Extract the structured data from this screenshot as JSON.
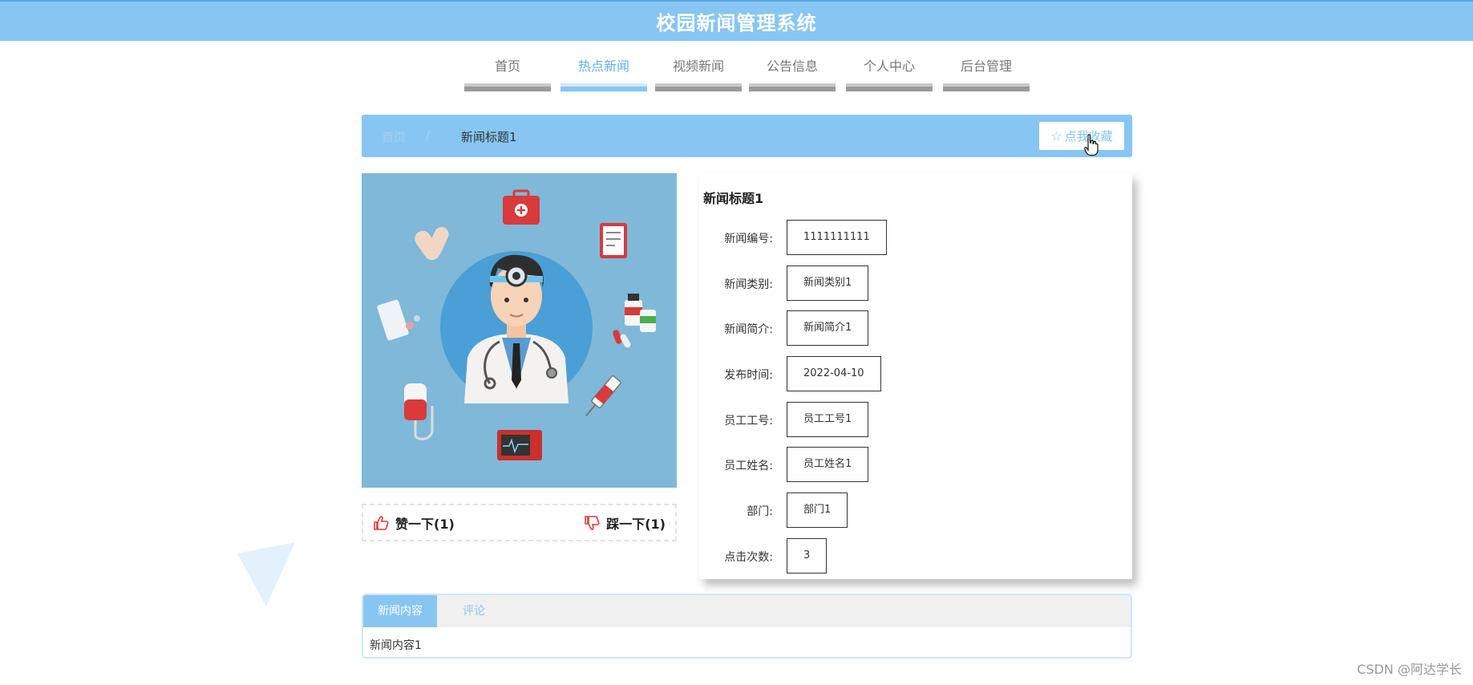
{
  "header": {
    "title": "校园新闻管理系统"
  },
  "nav": {
    "items": [
      {
        "label": "首页",
        "active": false
      },
      {
        "label": "热点新闻",
        "active": true
      },
      {
        "label": "视频新闻",
        "active": false
      },
      {
        "label": "公告信息",
        "active": false
      },
      {
        "label": "个人中心",
        "active": false
      },
      {
        "label": "后台管理",
        "active": false
      }
    ]
  },
  "breadcrumb": {
    "home": "首页",
    "separator": "/",
    "current": "新闻标题1",
    "favorite_label": "点我收藏",
    "favorite_icon": "star-icon"
  },
  "votes": {
    "like_label": "赞一下(1)",
    "dislike_label": "踩一下(1)"
  },
  "detail": {
    "title": "新闻标题1",
    "fields": [
      {
        "label": "新闻编号:",
        "value": "1111111111"
      },
      {
        "label": "新闻类别:",
        "value": "新闻类别1"
      },
      {
        "label": "新闻简介:",
        "value": "新闻简介1"
      },
      {
        "label": "发布时间:",
        "value": "2022-04-10"
      },
      {
        "label": "员工工号:",
        "value": "员工工号1"
      },
      {
        "label": "员工姓名:",
        "value": "员工姓名1"
      },
      {
        "label": "部门:",
        "value": "部门1"
      },
      {
        "label": "点击次数:",
        "value": "3"
      }
    ]
  },
  "tabs": {
    "items": [
      {
        "label": "新闻内容",
        "active": true
      },
      {
        "label": "评论",
        "active": false
      }
    ],
    "content": "新闻内容1"
  },
  "watermark": "CSDN @阿达学长",
  "colors": {
    "accent": "#87c6f2",
    "header_bg": "#87c6f2",
    "image_bg": "#7fb8d9",
    "vote_icon": "#e53935"
  }
}
